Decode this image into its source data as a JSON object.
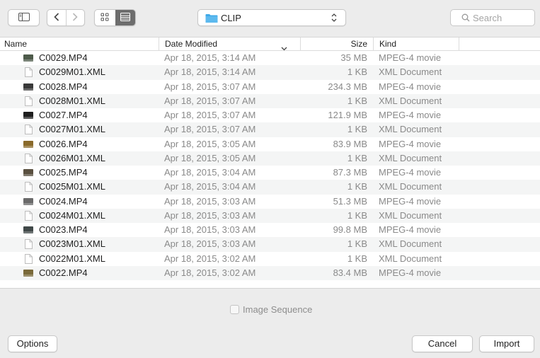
{
  "toolbar": {
    "location": "CLIP",
    "search_placeholder": "Search"
  },
  "columns": {
    "name": "Name",
    "date": "Date Modified",
    "size": "Size",
    "kind": "Kind"
  },
  "files": [
    {
      "name": "C0029.MP4",
      "date": "Apr 18, 2015, 3:14 AM",
      "size": "35 MB",
      "kind": "MPEG-4 movie",
      "icon": "video-thumbnail-icon",
      "thumb": "#4d5a4a"
    },
    {
      "name": "C0029M01.XML",
      "date": "Apr 18, 2015, 3:14 AM",
      "size": "1 KB",
      "kind": "XML Document",
      "icon": "document-icon"
    },
    {
      "name": "C0028.MP4",
      "date": "Apr 18, 2015, 3:07 AM",
      "size": "234.3 MB",
      "kind": "MPEG-4 movie",
      "icon": "video-thumbnail-icon",
      "thumb": "#3a3a3a"
    },
    {
      "name": "C0028M01.XML",
      "date": "Apr 18, 2015, 3:07 AM",
      "size": "1 KB",
      "kind": "XML Document",
      "icon": "document-icon"
    },
    {
      "name": "C0027.MP4",
      "date": "Apr 18, 2015, 3:07 AM",
      "size": "121.9 MB",
      "kind": "MPEG-4 movie",
      "icon": "video-thumbnail-icon",
      "thumb": "#1e1e1e"
    },
    {
      "name": "C0027M01.XML",
      "date": "Apr 18, 2015, 3:07 AM",
      "size": "1 KB",
      "kind": "XML Document",
      "icon": "document-icon"
    },
    {
      "name": "C0026.MP4",
      "date": "Apr 18, 2015, 3:05 AM",
      "size": "83.9 MB",
      "kind": "MPEG-4 movie",
      "icon": "video-thumbnail-icon",
      "thumb": "#8a6a2a"
    },
    {
      "name": "C0026M01.XML",
      "date": "Apr 18, 2015, 3:05 AM",
      "size": "1 KB",
      "kind": "XML Document",
      "icon": "document-icon"
    },
    {
      "name": "C0025.MP4",
      "date": "Apr 18, 2015, 3:04 AM",
      "size": "87.3 MB",
      "kind": "MPEG-4 movie",
      "icon": "video-thumbnail-icon",
      "thumb": "#5a5040"
    },
    {
      "name": "C0025M01.XML",
      "date": "Apr 18, 2015, 3:04 AM",
      "size": "1 KB",
      "kind": "XML Document",
      "icon": "document-icon"
    },
    {
      "name": "C0024.MP4",
      "date": "Apr 18, 2015, 3:03 AM",
      "size": "51.3 MB",
      "kind": "MPEG-4 movie",
      "icon": "video-thumbnail-icon",
      "thumb": "#6a6a6a"
    },
    {
      "name": "C0024M01.XML",
      "date": "Apr 18, 2015, 3:03 AM",
      "size": "1 KB",
      "kind": "XML Document",
      "icon": "document-icon"
    },
    {
      "name": "C0023.MP4",
      "date": "Apr 18, 2015, 3:03 AM",
      "size": "99.8 MB",
      "kind": "MPEG-4 movie",
      "icon": "video-thumbnail-icon",
      "thumb": "#404848"
    },
    {
      "name": "C0023M01.XML",
      "date": "Apr 18, 2015, 3:03 AM",
      "size": "1 KB",
      "kind": "XML Document",
      "icon": "document-icon"
    },
    {
      "name": "C0022M01.XML",
      "date": "Apr 18, 2015, 3:02 AM",
      "size": "1 KB",
      "kind": "XML Document",
      "icon": "document-icon"
    },
    {
      "name": "C0022.MP4",
      "date": "Apr 18, 2015, 3:02 AM",
      "size": "83.4 MB",
      "kind": "MPEG-4 movie",
      "icon": "video-thumbnail-icon",
      "thumb": "#7a6a3a"
    }
  ],
  "bottom": {
    "image_sequence_label": "Image Sequence",
    "image_sequence_checked": false,
    "options_label": "Options",
    "cancel_label": "Cancel",
    "import_label": "Import"
  },
  "colors": {
    "folder": "#3fa9e8",
    "secondary_text": "#8a8a8a",
    "selected_view": "#6d6d6d"
  }
}
